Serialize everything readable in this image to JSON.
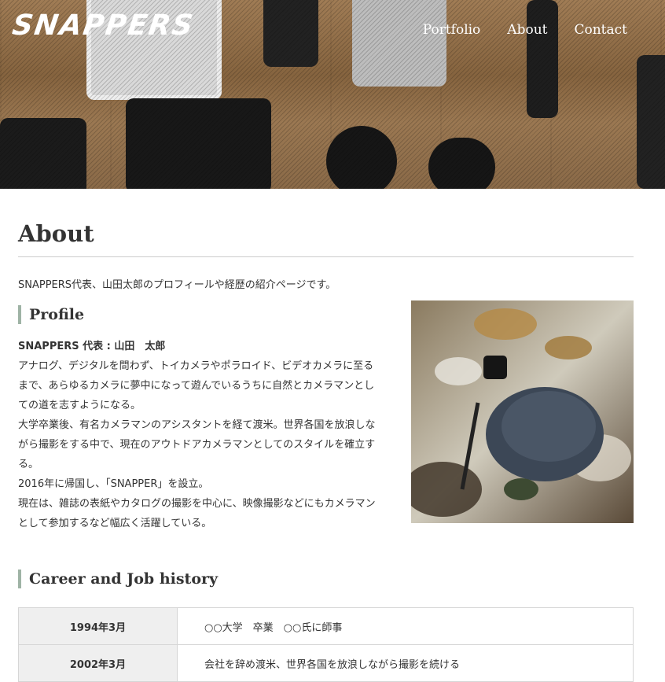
{
  "header": {
    "logo": "SNAPPERS",
    "nav": [
      {
        "label": "Portfolio"
      },
      {
        "label": "About"
      },
      {
        "label": "Contact"
      }
    ]
  },
  "page": {
    "title": "About",
    "intro": "SNAPPERS代表、山田太郎のプロフィールや経歴の紹介ページです。"
  },
  "profile": {
    "heading": "Profile",
    "name": "SNAPPERS 代表 : 山田　太郎",
    "paragraphs": [
      "アナログ、デジタルを問わず、トイカメラやポラロイド、ビデオカメラに至るまで、あらゆるカメラに夢中になって遊んでいるうちに自然とカメラマンとしての道を志すようになる。",
      "大学卒業後、有名カメラマンのアシスタントを経て渡米。世界各国を放浪しながら撮影をする中で、現在のアウトドアカメラマンとしてのスタイルを確立する。",
      "2016年に帰国し、「SNAPPER」を設立。",
      "現在は、雑誌の表紙やカタログの撮影を中心に、映像撮影などにもカメラマンとして参加するなど幅広く活躍している。"
    ]
  },
  "career": {
    "heading": "Career and Job history",
    "rows": [
      {
        "date": "1994年3月",
        "desc": "○○大学　卒業　○○氏に師事"
      },
      {
        "date": "2002年3月",
        "desc": "会社を辞め渡米、世界各国を放浪しながら撮影を続ける"
      }
    ]
  },
  "colors": {
    "heading_bar": "#9fb3a5",
    "table_date_bg": "#efefef",
    "divider": "#cccccc"
  }
}
